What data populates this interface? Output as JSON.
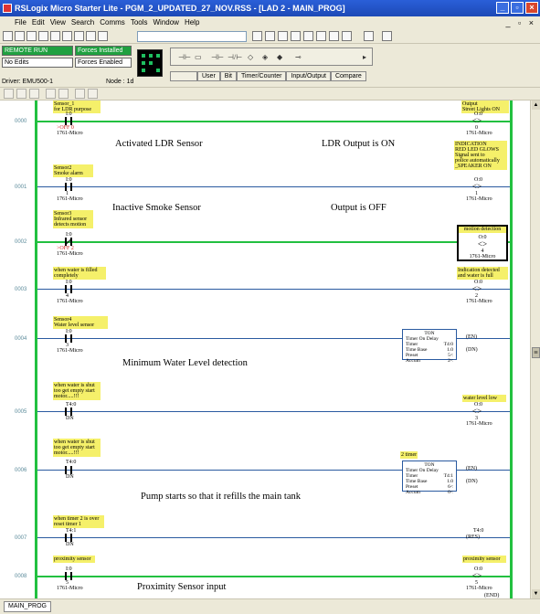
{
  "window": {
    "title": "RSLogix Micro Starter Lite - PGM_2_UPDATED_27_NOV.RSS - [LAD 2 - MAIN_PROG]",
    "controls": {
      "minimize": "_",
      "maximize": "▫",
      "close": "×"
    }
  },
  "menu": {
    "items": [
      "File",
      "Edit",
      "View",
      "Search",
      "Comms",
      "Tools",
      "Window",
      "Help"
    ],
    "mdi_controls": "_ ▫ ×"
  },
  "status": {
    "run_mode": "REMOTE RUN",
    "edits": "No Edits",
    "forces_installed": "Forces Installed",
    "forces_enabled": "Forces Enabled",
    "driver": "Driver: EMU500-1",
    "node": "Node : 1d"
  },
  "instruction_tabs": [
    "User",
    "Bit",
    "Timer/Counter",
    "Input/Output",
    "Compare"
  ],
  "sheet_tab": "MAIN_PROG",
  "rungs": [
    {
      "number": "0000",
      "input": {
        "comment": [
          "Sensor_1",
          "for LDR purpose"
        ],
        "address": "I:0",
        "bit": "0",
        "device": "1761-Micro",
        "force": ">OFF 0"
      },
      "output": {
        "comment": [
          "Output",
          "Street Lights ON"
        ],
        "address": "O:0",
        "bit": "0",
        "device": "1761-Micro"
      },
      "captions": [
        "Activated LDR Sensor",
        "LDR Output is ON"
      ]
    },
    {
      "number": "0001",
      "input": {
        "comment": [
          "Sensor2",
          "Smoke alarm"
        ],
        "address": "I:0",
        "bit": "1",
        "device": "1761-Micro"
      },
      "output": {
        "comment": [
          "INDICATION",
          "RED LED GLOWS",
          "Signal sent to",
          "police automatically",
          "_SPEAKER ON"
        ],
        "address": "O:0",
        "bit": "1",
        "device": "1761-Micro"
      },
      "captions": [
        "Inactive Smoke Sensor",
        "Output is OFF"
      ]
    },
    {
      "number": "0002",
      "input": {
        "comment": [
          "Sensor3",
          "Infrared sensor",
          "detects motion"
        ],
        "address": "I:0",
        "bit": "2",
        "device": "1761-Micro",
        "force": ">OFF 2"
      },
      "output": {
        "comment": [
          "motion detection"
        ],
        "address": "O:0",
        "bit": "4",
        "device": "1761-Micro"
      }
    },
    {
      "number": "0003",
      "input": {
        "comment": [
          "when water is filled",
          "completely"
        ],
        "address": "I:0",
        "bit": "4",
        "device": "1761-Micro"
      },
      "output": {
        "comment": [
          "Indication detected",
          "and water is full"
        ],
        "address": "O:0",
        "bit": "2",
        "device": "1761-Micro"
      }
    },
    {
      "number": "0004",
      "input": {
        "comment": [
          "Sensor4",
          "Water level sensor"
        ],
        "address": "I:0",
        "bit": "3",
        "device": "1761-Micro"
      },
      "timer": {
        "header": "TON",
        "title": "Timer On Delay",
        "timer": "T4:0",
        "time_base": "1.0",
        "preset": "5<",
        "accum": "2<"
      },
      "outputs": [
        "(EN)",
        "(DN)"
      ],
      "captions": [
        "Minimum Water Level detection"
      ]
    },
    {
      "number": "0005",
      "input": {
        "comment": [
          "when water is shut",
          "too get empty start",
          "motor.....!!!"
        ],
        "address": "T4:0",
        "bit": "DN"
      },
      "output": {
        "comment": [
          "water level low"
        ],
        "address": "O:0",
        "bit": "3",
        "device": "1761-Micro"
      }
    },
    {
      "number": "0006",
      "input": {
        "comment": [
          "when water is shut",
          "too get empty start",
          "motor.....!!!"
        ],
        "address": "T4:0",
        "bit": "DN"
      },
      "timer": {
        "label": "2 timer",
        "header": "TON",
        "title": "Timer On Delay",
        "timer": "T4:1",
        "time_base": "1.0",
        "preset": "6<",
        "accum": "0<"
      },
      "outputs": [
        "(EN)",
        "(DN)"
      ],
      "captions": [
        "Pump starts so that it refills the main tank"
      ]
    },
    {
      "number": "0007",
      "input": {
        "comment": [
          "when timer 2 is over",
          "reset timer 1"
        ],
        "address": "T4:1",
        "bit": "DN"
      },
      "output": {
        "address": "T4:0",
        "type": "(RES)"
      }
    },
    {
      "number": "0008",
      "input": {
        "comment": [
          "proximity sensor"
        ],
        "address": "I:0",
        "bit": "5",
        "device": "1761-Micro"
      },
      "output": {
        "comment": [
          "proximity sensor"
        ],
        "address": "O:0",
        "bit": "5",
        "device": "1761-Micro"
      },
      "captions": [
        "Proximity Sensor input"
      ]
    },
    {
      "number": "0009",
      "output": {
        "type": "(END)"
      }
    }
  ]
}
